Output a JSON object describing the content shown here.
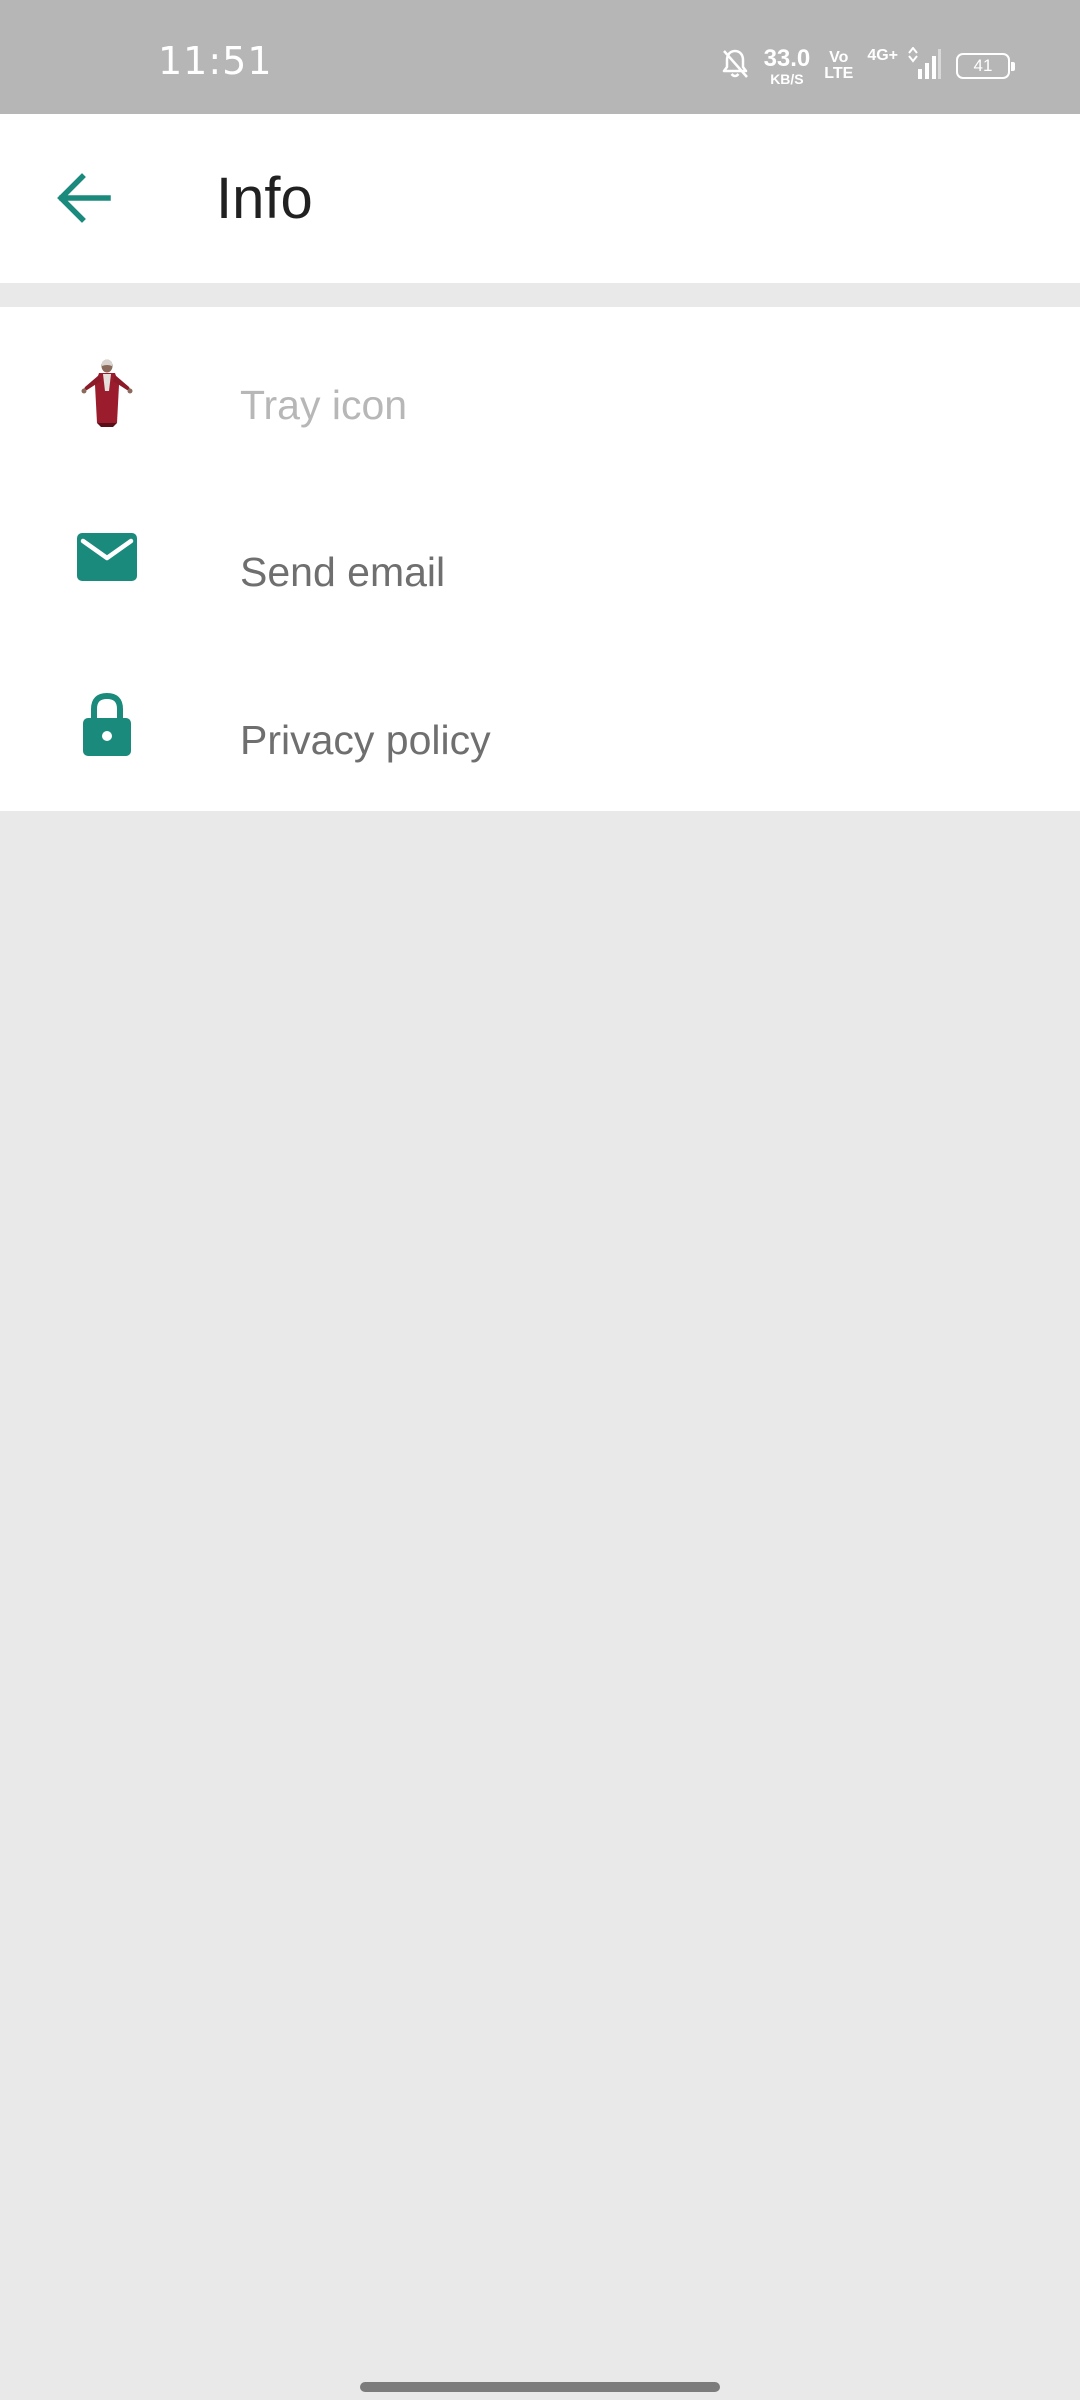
{
  "status_bar": {
    "time": "11:51",
    "net_speed_value": "33.0",
    "net_speed_unit": "KB/S",
    "volte_top": "Vo",
    "volte_bottom": "LTE",
    "network_type": "4G+",
    "battery_level": "41",
    "icons": [
      "bell-muted-icon",
      "signal-icon",
      "battery-icon"
    ]
  },
  "app_bar": {
    "back_icon": "arrow-back-icon",
    "title": "Info"
  },
  "list": {
    "items": [
      {
        "icon": "tray-figure-icon",
        "label": "Tray icon",
        "enabled": false
      },
      {
        "icon": "mail-icon",
        "label": "Send email",
        "enabled": true
      },
      {
        "icon": "lock-icon",
        "label": "Privacy policy",
        "enabled": true
      }
    ]
  },
  "colors": {
    "accent": "#1a8a7d",
    "status_bar_bg": "#b6b6b6",
    "page_bg": "#e9e9e9",
    "title_text": "#212121",
    "item_text": "#6f6f6f",
    "disabled_text": "#b7b7b7"
  }
}
